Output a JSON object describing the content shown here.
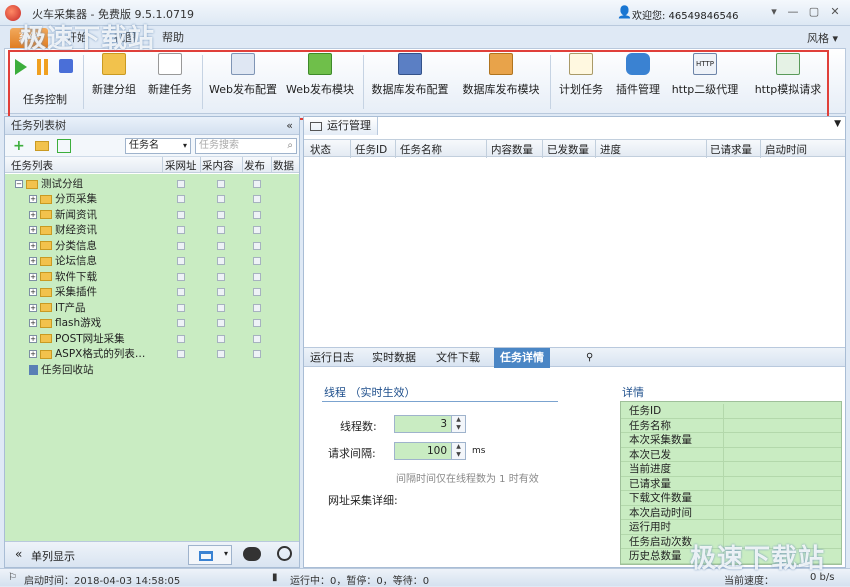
{
  "window": {
    "title": "火车采集器 - 免费版 9.5.1.0719",
    "welcome": "欢迎您: 46549846546",
    "controls": [
      "▾",
      "—",
      "▢",
      "✕"
    ]
  },
  "watermark": "极速下载站",
  "menu_tabs": [
    "系统",
    "开始",
    "视图",
    "帮助"
  ],
  "style_menu": "风格 ▾",
  "ribbon": {
    "task_control": "任务控制",
    "buttons": [
      "新建分组",
      "新建任务",
      "Web发布配置",
      "Web发布模块",
      "数据库发布配置",
      "数据库发布模块",
      "计划任务",
      "插件管理",
      "http二级代理",
      "http模拟请求"
    ]
  },
  "left": {
    "title": "任务列表树",
    "collapse": "«",
    "filter_select": "任务名",
    "search_placeholder": "任务搜索",
    "columns": [
      "任务列表",
      "采网址",
      "采内容",
      "发布",
      "数据量"
    ],
    "root": "测试分组",
    "children": [
      "分页采集",
      "新闻资讯",
      "财经资讯",
      "分类信息",
      "论坛信息",
      "软件下载",
      "采集插件",
      "IT产品",
      "flash游戏",
      "POST网址采集",
      "ASPX格式的列表…"
    ],
    "recycle": "任务回收站",
    "footer_label": "单列显示"
  },
  "right": {
    "tab": "运行管理",
    "columns": [
      "状态",
      "任务ID",
      "任务名称",
      "内容数量",
      "已发数量",
      "进度",
      "已请求量",
      "启动时间"
    ],
    "sub_tabs": [
      "运行日志",
      "实时数据",
      "文件下载",
      "任务详情"
    ],
    "section_title": "线程 （实时生效）",
    "threads_label": "线程数:",
    "threads_value": "3",
    "interval_label": "请求间隔:",
    "interval_value": "100",
    "interval_unit": "ms",
    "hint": "间隔时间仅在线程数为 1 时有效",
    "url_detail_label": "网址采集详细:",
    "details_title": "详情",
    "details": [
      "任务ID",
      "任务名称",
      "本次采集数量",
      "本次已发",
      "当前进度",
      "已请求量",
      "下载文件数量",
      "本次启动时间",
      "运行用时",
      "任务启动次数",
      "历史总数量"
    ]
  },
  "status": {
    "start_time": "启动时间：2018-04-03 14:58:05",
    "running": "运行中：0，暂停：0，等待：0",
    "speed": "当前速度：",
    "speed_value": "0 b/s"
  }
}
